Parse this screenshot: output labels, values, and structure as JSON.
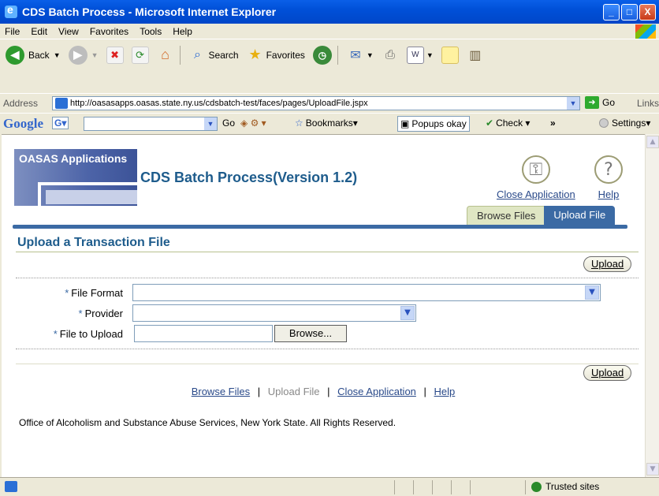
{
  "window": {
    "title": "CDS Batch Process - Microsoft Internet Explorer",
    "controls": [
      "_",
      "□",
      "X"
    ]
  },
  "menu": {
    "items": [
      "File",
      "Edit",
      "View",
      "Favorites",
      "Tools",
      "Help"
    ]
  },
  "toolbar": {
    "back_label": "Back",
    "search_label": "Search",
    "favorites_label": "Favorites"
  },
  "address": {
    "label": "Address",
    "url": "http://oasasapps.oasas.state.ny.us/cdsbatch-test/faces/pages/UploadFile.jspx",
    "go_label": "Go",
    "links_label": "Links"
  },
  "google": {
    "logo": "Google",
    "g_label": "G▾",
    "go_label": "Go",
    "bookmarks_label": "Bookmarks▾",
    "popups_label": "Popups okay",
    "check_label": "Check ▾",
    "more_label": "»",
    "settings_label": "Settings▾"
  },
  "app": {
    "logo_text": "OASAS Applications",
    "title": "CDS Batch Process(Version 1.2)",
    "close_app": "Close Application",
    "help": "Help"
  },
  "tabs": [
    {
      "label": "Browse Files",
      "selected": false
    },
    {
      "label": "Upload File",
      "selected": true
    }
  ],
  "page": {
    "title": "Upload a Transaction File",
    "upload_button": "Upload",
    "fields": {
      "file_format_label": "File Format",
      "provider_label": "Provider",
      "file_to_upload_label": "File to Upload",
      "browse_button": "Browse..."
    },
    "footer_links": {
      "browse_files": "Browse Files",
      "upload_file": "Upload File",
      "close_application": "Close Application",
      "help": "Help",
      "separator": "|"
    },
    "copyright": "Office of Alcoholism and Substance Abuse Services, New York State. All Rights Reserved."
  },
  "status": {
    "zone": "Trusted sites"
  }
}
